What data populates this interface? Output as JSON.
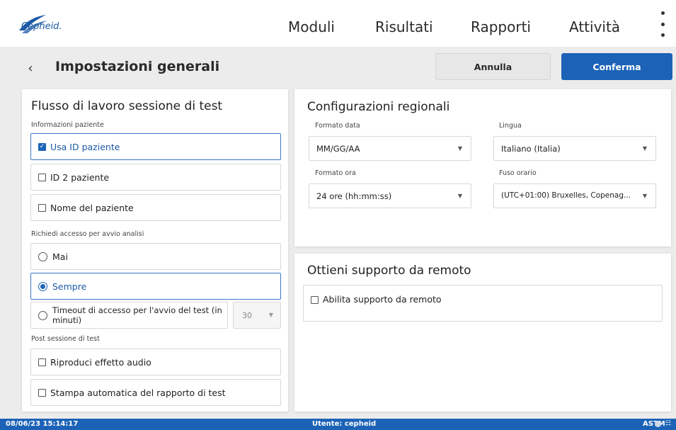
{
  "app": {
    "logo_text": "Cepheid."
  },
  "nav": {
    "items": [
      "Moduli",
      "Risultati",
      "Rapporti",
      "Attività"
    ]
  },
  "header": {
    "title": "Impostazioni generali",
    "cancel_label": "Annulla",
    "confirm_label": "Conferma"
  },
  "workflow": {
    "title": "Flusso di lavoro sessione di test",
    "patient_info_label": "Informazioni paziente",
    "patient_options": [
      {
        "label": "Usa ID paziente",
        "checked": true
      },
      {
        "label": "ID 2 paziente",
        "checked": false
      },
      {
        "label": "Nome del paziente",
        "checked": false
      }
    ],
    "login_label": "Richiedi accesso per avvio analisi",
    "login_options": [
      {
        "label": "Mai",
        "selected": false
      },
      {
        "label": "Sempre",
        "selected": true
      },
      {
        "label": "Timeout di accesso per l'avvio del test (in minuti)",
        "selected": false
      }
    ],
    "timeout_value": "30",
    "post_label": "Post sessione di test",
    "post_options": [
      {
        "label": "Riproduci effetto audio",
        "checked": false
      },
      {
        "label": "Stampa automatica del rapporto di test",
        "checked": false
      }
    ]
  },
  "regional": {
    "title": "Configurazioni regionali",
    "date_format_label": "Formato data",
    "date_format_value": "MM/GG/AA",
    "language_label": "Lingua",
    "language_value": "Italiano (Italia)",
    "time_format_label": "Formato ora",
    "time_format_value": "24 ore (hh:mm:ss)",
    "timezone_label": "Fuso orario",
    "timezone_value": "(UTC+01:00) Bruxelles, Copenag..."
  },
  "remote": {
    "title": "Ottieni supporto da remoto",
    "enable_label": "Abilita supporto da remoto",
    "enable_checked": false
  },
  "status": {
    "datetime": "08/06/23 15:14:17",
    "user": "Utente: cepheid",
    "protocol": "ASTM"
  },
  "colors": {
    "brand_blue": "#1c63b7",
    "background": "#ececec"
  }
}
